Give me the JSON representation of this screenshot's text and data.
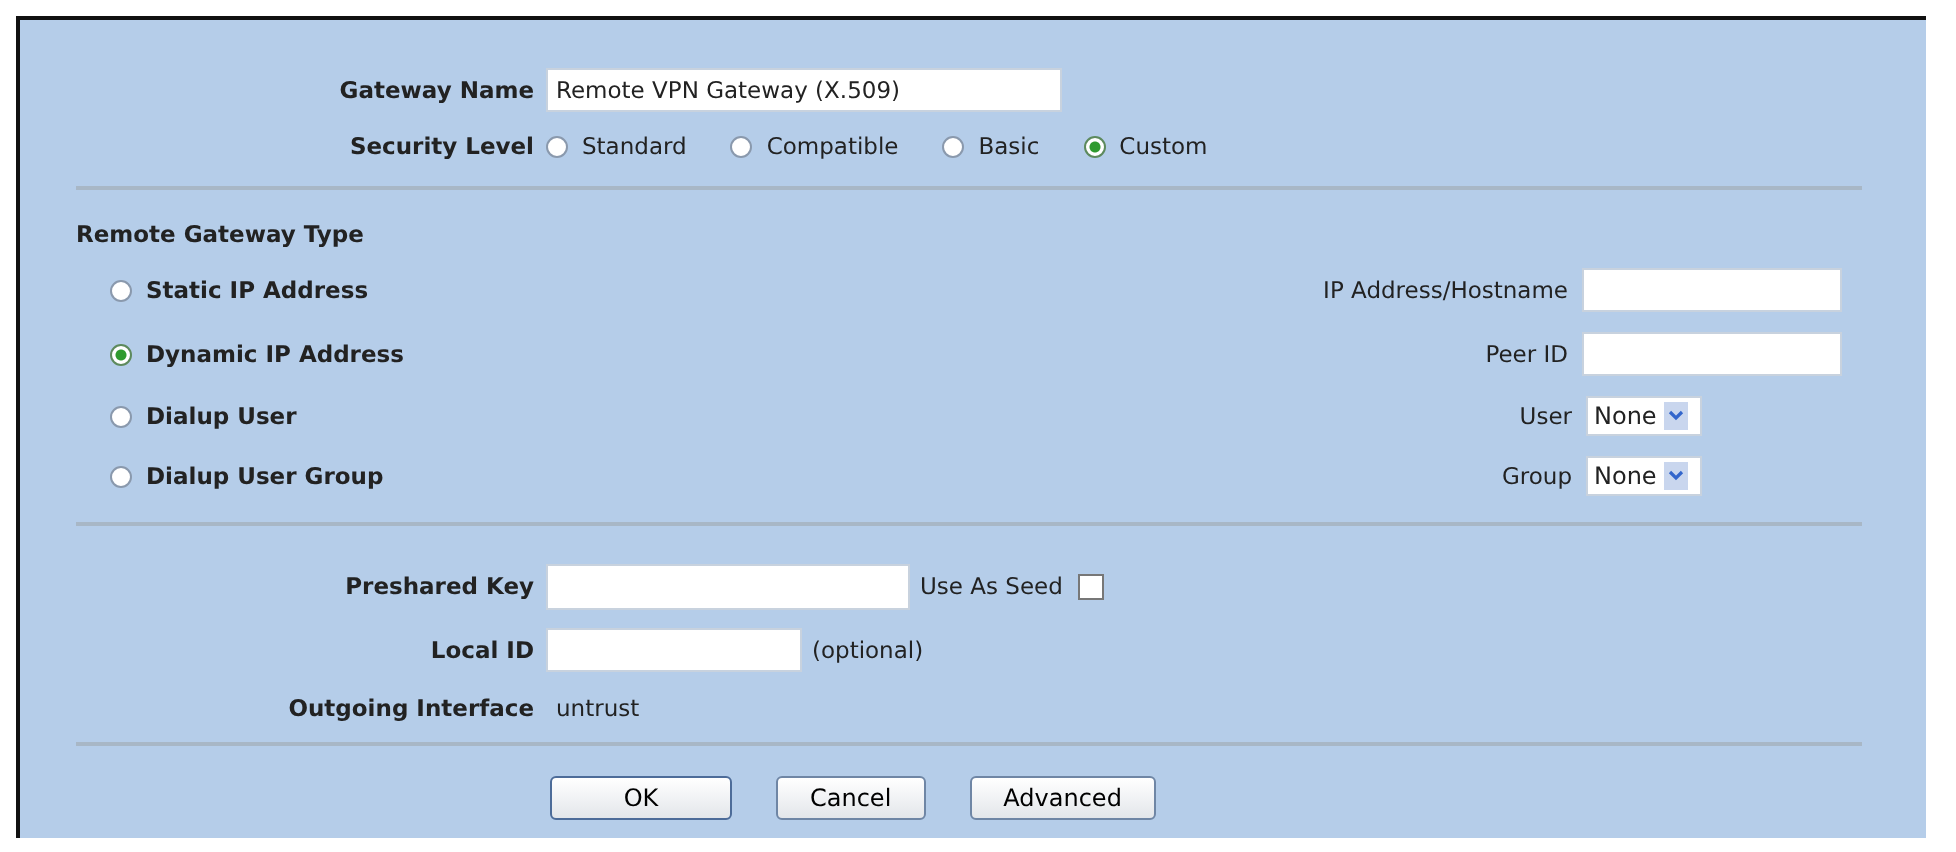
{
  "gateway_name": {
    "label": "Gateway Name",
    "value": "Remote VPN Gateway (X.509)"
  },
  "security_level": {
    "label": "Security Level",
    "options": [
      {
        "label": "Standard",
        "selected": false
      },
      {
        "label": "Compatible",
        "selected": false
      },
      {
        "label": "Basic",
        "selected": false
      },
      {
        "label": "Custom",
        "selected": true
      }
    ]
  },
  "remote_gateway_type": {
    "title": "Remote Gateway Type",
    "options": [
      {
        "label": "Static IP Address",
        "selected": false
      },
      {
        "label": "Dynamic IP Address",
        "selected": true
      },
      {
        "label": "Dialup User",
        "selected": false
      },
      {
        "label": "Dialup User Group",
        "selected": false
      }
    ],
    "fields": [
      {
        "kind": "text",
        "label": "IP Address/Hostname"
      },
      {
        "kind": "text",
        "label": "Peer ID"
      },
      {
        "kind": "select",
        "label": "User",
        "value": "None"
      },
      {
        "kind": "select",
        "label": "Group",
        "value": "None"
      }
    ]
  },
  "preshared_key": {
    "label": "Preshared Key",
    "seed_label": "Use As Seed",
    "seed_checked": false
  },
  "local_id": {
    "label": "Local ID",
    "hint": "(optional)"
  },
  "outgoing_interface": {
    "label": "Outgoing Interface",
    "value": "untrust"
  },
  "buttons": [
    "OK",
    "Cancel",
    "Advanced"
  ]
}
